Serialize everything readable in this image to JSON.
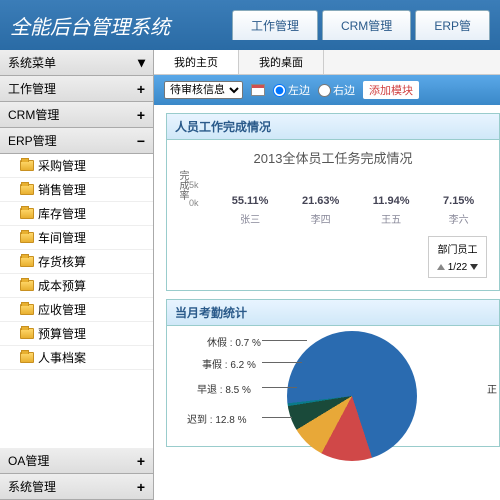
{
  "header": {
    "logo": "全能后台管理系统",
    "tabs": [
      "工作管理",
      "CRM管理",
      "ERP管"
    ]
  },
  "sidebar": {
    "title": "系统菜单",
    "groups": [
      {
        "label": "工作管理",
        "toggle": "+"
      },
      {
        "label": "CRM管理",
        "toggle": "+"
      },
      {
        "label": "ERP管理",
        "toggle": "−",
        "items": [
          "采购管理",
          "销售管理",
          "库存管理",
          "车间管理",
          "存货核算",
          "成本预算",
          "应收管理",
          "预算管理",
          "人事档案"
        ]
      },
      {
        "label": "OA管理",
        "toggle": "+"
      },
      {
        "label": "系统管理",
        "toggle": "+"
      }
    ]
  },
  "subtabs": {
    "t1": "我的主页",
    "t2": "我的桌面"
  },
  "toolbar": {
    "select_label": "待审核信息",
    "left": "左边",
    "right": "右边",
    "add": "添加模块"
  },
  "panel1": {
    "title": "人员工作完成情况",
    "legend": "部门员工",
    "pager": "1/22"
  },
  "chart_data": {
    "type": "bar",
    "title": "2013全体员工任务完成情况",
    "ylabel": "完成率",
    "yticks": [
      "5k",
      "0k"
    ],
    "categories": [
      "张三",
      "李四",
      "王五",
      "李六"
    ],
    "values_label": [
      "55.11%",
      "21.63%",
      "11.94%",
      "7.15%"
    ],
    "values": [
      55.11,
      21.63,
      11.94,
      7.15
    ]
  },
  "panel2": {
    "title": "当月考勤统计"
  },
  "pie_data": {
    "type": "pie",
    "labels": [
      {
        "name": "休假",
        "pct": "0.7 %"
      },
      {
        "name": "事假",
        "pct": "6.2 %"
      },
      {
        "name": "早退",
        "pct": "8.5 %"
      },
      {
        "name": "迟到",
        "pct": "12.8 %"
      }
    ],
    "right_partial": "正"
  }
}
